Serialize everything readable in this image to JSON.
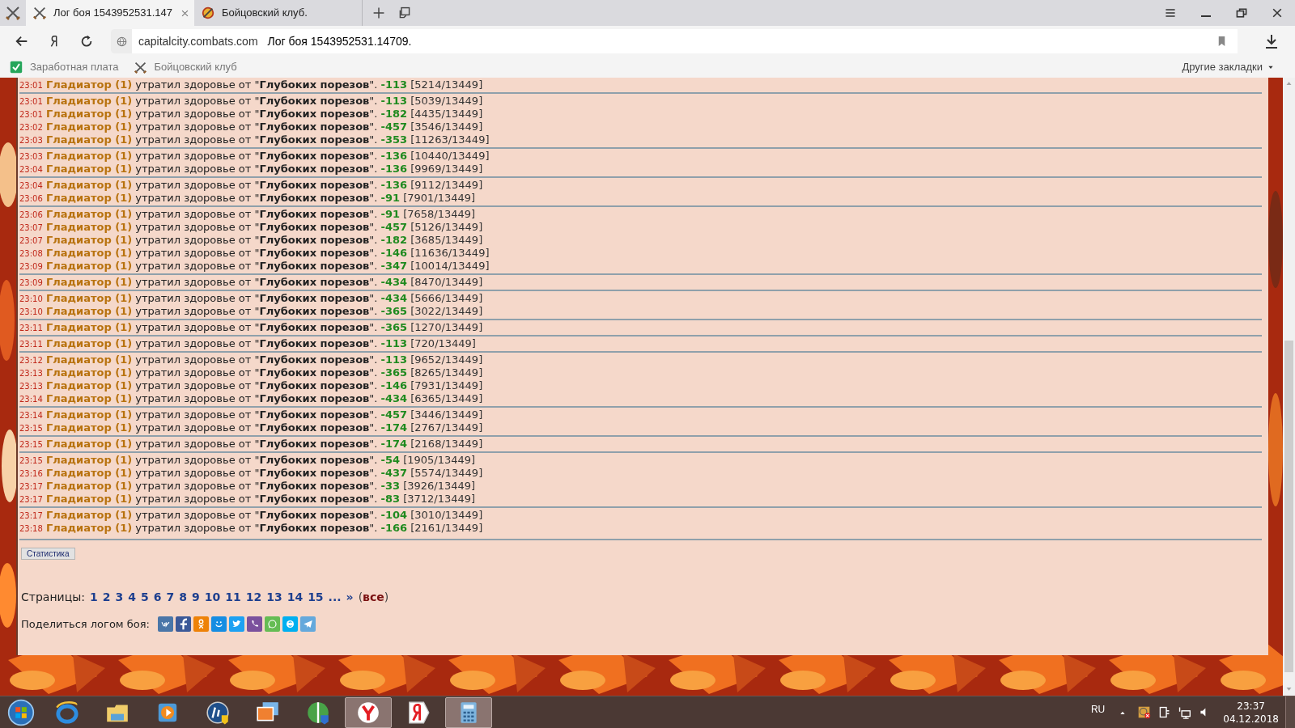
{
  "tabs": [
    {
      "title": "Лог боя 1543952531.147",
      "selected": true,
      "closable": true
    },
    {
      "title": "Бойцовский клуб.",
      "selected": false,
      "closable": false
    }
  ],
  "address_bar": {
    "domain": "capitalcity.combats.com",
    "page_title": "Лог боя 1543952531.14709."
  },
  "bookmarks": [
    {
      "label": "Заработная плата",
      "kind": "check"
    },
    {
      "label": "Бойцовский клуб",
      "kind": "swords"
    }
  ],
  "other_bookmarks": "Другие закладки",
  "log": {
    "groups": [
      [
        {
          "time": "23:01",
          "actor": "Гладиатор (1)",
          "message": "утратил здоровье от \"**Глубоких порезов**\".",
          "damage": "-113",
          "hp": "[5214/13449]"
        }
      ],
      [
        {
          "time": "23:01",
          "actor": "Гладиатор (1)",
          "message": "утратил здоровье от \"**Глубоких порезов**\".",
          "damage": "-113",
          "hp": "[5039/13449]"
        },
        {
          "time": "23:01",
          "actor": "Гладиатор (1)",
          "message": "утратил здоровье от \"**Глубоких порезов**\".",
          "damage": "-182",
          "hp": "[4435/13449]"
        },
        {
          "time": "23:02",
          "actor": "Гладиатор (1)",
          "message": "утратил здоровье от \"**Глубоких порезов**\".",
          "damage": "-457",
          "hp": "[3546/13449]"
        },
        {
          "time": "23:03",
          "actor": "Гладиатор (1)",
          "message": "утратил здоровье от \"**Глубоких порезов**\".",
          "damage": "-353",
          "hp": "[11263/13449]"
        }
      ],
      [
        {
          "time": "23:03",
          "actor": "Гладиатор (1)",
          "message": "утратил здоровье от \"**Глубоких порезов**\".",
          "damage": "-136",
          "hp": "[10440/13449]"
        },
        {
          "time": "23:04",
          "actor": "Гладиатор (1)",
          "message": "утратил здоровье от \"**Глубоких порезов**\".",
          "damage": "-136",
          "hp": "[9969/13449]"
        }
      ],
      [
        {
          "time": "23:04",
          "actor": "Гладиатор (1)",
          "message": "утратил здоровье от \"**Глубоких порезов**\".",
          "damage": "-136",
          "hp": "[9112/13449]"
        },
        {
          "time": "23:06",
          "actor": "Гладиатор (1)",
          "message": "утратил здоровье от \"**Глубоких порезов**\".",
          "damage": "-91",
          "hp": "[7901/13449]"
        }
      ],
      [
        {
          "time": "23:06",
          "actor": "Гладиатор (1)",
          "message": "утратил здоровье от \"**Глубоких порезов**\".",
          "damage": "-91",
          "hp": "[7658/13449]"
        },
        {
          "time": "23:07",
          "actor": "Гладиатор (1)",
          "message": "утратил здоровье от \"**Глубоких порезов**\".",
          "damage": "-457",
          "hp": "[5126/13449]"
        },
        {
          "time": "23:07",
          "actor": "Гладиатор (1)",
          "message": "утратил здоровье от \"**Глубоких порезов**\".",
          "damage": "-182",
          "hp": "[3685/13449]"
        },
        {
          "time": "23:08",
          "actor": "Гладиатор (1)",
          "message": "утратил здоровье от \"**Глубоких порезов**\".",
          "damage": "-146",
          "hp": "[11636/13449]"
        },
        {
          "time": "23:09",
          "actor": "Гладиатор (1)",
          "message": "утратил здоровье от \"**Глубоких порезов**\".",
          "damage": "-347",
          "hp": "[10014/13449]"
        }
      ],
      [
        {
          "time": "23:09",
          "actor": "Гладиатор (1)",
          "message": "утратил здоровье от \"**Глубоких порезов**\".",
          "damage": "-434",
          "hp": "[8470/13449]"
        }
      ],
      [
        {
          "time": "23:10",
          "actor": "Гладиатор (1)",
          "message": "утратил здоровье от \"**Глубоких порезов**\".",
          "damage": "-434",
          "hp": "[5666/13449]"
        },
        {
          "time": "23:10",
          "actor": "Гладиатор (1)",
          "message": "утратил здоровье от \"**Глубоких порезов**\".",
          "damage": "-365",
          "hp": "[3022/13449]"
        }
      ],
      [
        {
          "time": "23:11",
          "actor": "Гладиатор (1)",
          "message": "утратил здоровье от \"**Глубоких порезов**\".",
          "damage": "-365",
          "hp": "[1270/13449]"
        }
      ],
      [
        {
          "time": "23:11",
          "actor": "Гладиатор (1)",
          "message": "утратил здоровье от \"**Глубоких порезов**\".",
          "damage": "-113",
          "hp": "[720/13449]"
        }
      ],
      [
        {
          "time": "23:12",
          "actor": "Гладиатор (1)",
          "message": "утратил здоровье от \"**Глубоких порезов**\".",
          "damage": "-113",
          "hp": "[9652/13449]"
        },
        {
          "time": "23:13",
          "actor": "Гладиатор (1)",
          "message": "утратил здоровье от \"**Глубоких порезов**\".",
          "damage": "-365",
          "hp": "[8265/13449]"
        },
        {
          "time": "23:13",
          "actor": "Гладиатор (1)",
          "message": "утратил здоровье от \"**Глубоких порезов**\".",
          "damage": "-146",
          "hp": "[7931/13449]"
        },
        {
          "time": "23:14",
          "actor": "Гладиатор (1)",
          "message": "утратил здоровье от \"**Глубоких порезов**\".",
          "damage": "-434",
          "hp": "[6365/13449]"
        }
      ],
      [
        {
          "time": "23:14",
          "actor": "Гладиатор (1)",
          "message": "утратил здоровье от \"**Глубоких порезов**\".",
          "damage": "-457",
          "hp": "[3446/13449]"
        },
        {
          "time": "23:15",
          "actor": "Гладиатор (1)",
          "message": "утратил здоровье от \"**Глубоких порезов**\".",
          "damage": "-174",
          "hp": "[2767/13449]"
        }
      ],
      [
        {
          "time": "23:15",
          "actor": "Гладиатор (1)",
          "message": "утратил здоровье от \"**Глубоких порезов**\".",
          "damage": "-174",
          "hp": "[2168/13449]"
        }
      ],
      [
        {
          "time": "23:15",
          "actor": "Гладиатор (1)",
          "message": "утратил здоровье от \"**Глубоких порезов**\".",
          "damage": "-54",
          "hp": "[1905/13449]"
        },
        {
          "time": "23:16",
          "actor": "Гладиатор (1)",
          "message": "утратил здоровье от \"**Глубоких порезов**\".",
          "damage": "-437",
          "hp": "[5574/13449]"
        },
        {
          "time": "23:17",
          "actor": "Гладиатор (1)",
          "message": "утратил здоровье от \"**Глубоких порезов**\".",
          "damage": "-33",
          "hp": "[3926/13449]"
        },
        {
          "time": "23:17",
          "actor": "Гладиатор (1)",
          "message": "утратил здоровье от \"**Глубоких порезов**\".",
          "damage": "-83",
          "hp": "[3712/13449]"
        }
      ],
      [
        {
          "time": "23:17",
          "actor": "Гладиатор (1)",
          "message": "утратил здоровье от \"**Глубоких порезов**\".",
          "damage": "-104",
          "hp": "[3010/13449]"
        },
        {
          "time": "23:18",
          "actor": "Гладиатор (1)",
          "message": "утратил здоровье от \"**Глубоких порезов**\".",
          "damage": "-166",
          "hp": "[2161/13449]"
        }
      ]
    ]
  },
  "stats_button": "Статистика",
  "pagination": {
    "label": "Страницы:",
    "links": [
      {
        "text": "1",
        "selected": false
      },
      {
        "text": "2",
        "selected": false
      },
      {
        "text": "3",
        "selected": false
      },
      {
        "text": "4",
        "selected": false
      },
      {
        "text": "5",
        "selected": false
      },
      {
        "text": "6",
        "selected": false
      },
      {
        "text": "7",
        "selected": false
      },
      {
        "text": "8",
        "selected": false
      },
      {
        "text": "9",
        "selected": false
      },
      {
        "text": "10",
        "selected": false
      },
      {
        "text": "11",
        "selected": false
      },
      {
        "text": "12",
        "selected": false
      },
      {
        "text": "13",
        "selected": false
      },
      {
        "text": "14",
        "selected": false
      },
      {
        "text": "15",
        "selected": false
      },
      {
        "text": "...",
        "selected": false
      },
      {
        "text": "»",
        "selected": false
      }
    ],
    "all": {
      "before": "(",
      "text": "все",
      "after": ")",
      "selected": true
    }
  },
  "share": {
    "label": "Поделиться логом боя:",
    "icons": [
      {
        "kind": "vk",
        "color": "#4a76a8"
      },
      {
        "kind": "facebook",
        "color": "#3b5998"
      },
      {
        "kind": "ok",
        "color": "#ee8208"
      },
      {
        "kind": "mail",
        "color": "#168de2"
      },
      {
        "kind": "twitter",
        "color": "#1da1f2"
      },
      {
        "kind": "viber",
        "color": "#7b519d"
      },
      {
        "kind": "whatsapp",
        "color": "#65bc54"
      },
      {
        "kind": "skype",
        "color": "#00aff0"
      },
      {
        "kind": "telegram",
        "color": "#64a9dc"
      }
    ]
  },
  "taskbar": {
    "items": [
      {
        "kind": "ie",
        "selected": false
      },
      {
        "kind": "folder",
        "selected": false
      },
      {
        "kind": "media",
        "selected": false
      },
      {
        "kind": "hp",
        "selected": false
      },
      {
        "kind": "photos",
        "selected": false
      },
      {
        "kind": "globe",
        "selected": false
      },
      {
        "kind": "ybrowser",
        "selected": true
      },
      {
        "kind": "yandex",
        "selected": false
      },
      {
        "kind": "calculator",
        "selected": true
      }
    ],
    "language": "RU",
    "time": "23:37",
    "date": "04.12.2018"
  }
}
